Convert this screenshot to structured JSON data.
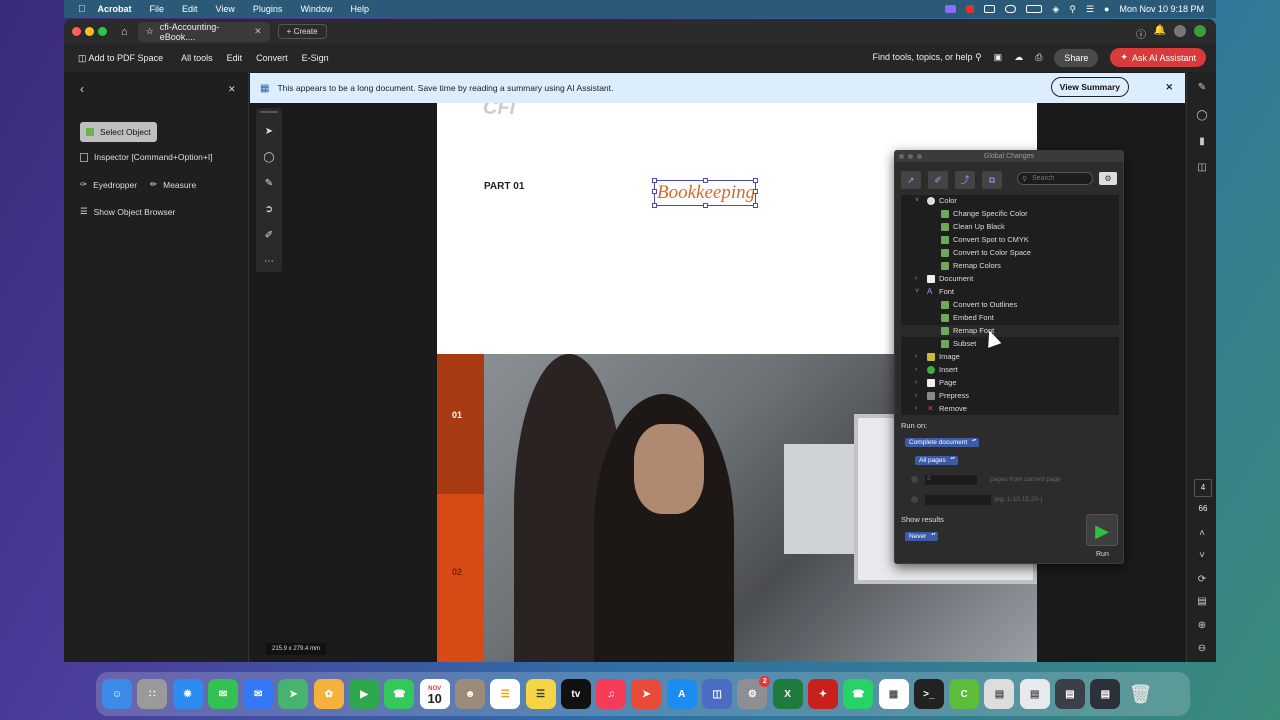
{
  "menubar": {
    "app": "Acrobat",
    "items": [
      "File",
      "Edit",
      "View",
      "Plugins",
      "Window",
      "Help"
    ],
    "clock": "Mon Nov 10  9:18 PM"
  },
  "tabs": {
    "active_tab": "cfi-Accounting-eBook....",
    "new_tab": "Create"
  },
  "toolbar": {
    "add_to_pdf_space": "Add to PDF Space",
    "all_tools": "All tools",
    "edit": "Edit",
    "convert": "Convert",
    "esign": "E-Sign",
    "find": "Find tools, topics, or help",
    "share": "Share",
    "ask_ai": "Ask AI Assistant"
  },
  "left_panel": {
    "select_object": "Select Object",
    "inspector": "Inspector [Command+Option+I]",
    "eyedropper": "Eyedropper",
    "measure": "Measure",
    "show_object_browser": "Show Object Browser"
  },
  "banner": {
    "text": "This appears to be a long document. Save time by reading a summary using AI Assistant.",
    "view_summary": "View Summary"
  },
  "document": {
    "header_logo": "CFI",
    "part_label": "PART 01",
    "title_word": "Bookkeeping",
    "num_01": "01",
    "num_02": "02",
    "dimensions": "215.9 x 279.4 mm"
  },
  "global_changes": {
    "title": "Global Changes",
    "search_placeholder": "Search",
    "tree": [
      {
        "label": "Color",
        "level": 0,
        "expanded": true
      },
      {
        "label": "Change Specific Color",
        "level": 1
      },
      {
        "label": "Clean Up Black",
        "level": 1
      },
      {
        "label": "Convert Spot to CMYK",
        "level": 1
      },
      {
        "label": "Convert to Color Space",
        "level": 1
      },
      {
        "label": "Remap Colors",
        "level": 1
      },
      {
        "label": "Document",
        "level": 0,
        "expanded": false
      },
      {
        "label": "Font",
        "level": 0,
        "expanded": true
      },
      {
        "label": "Convert to Outlines",
        "level": 1
      },
      {
        "label": "Embed Font",
        "level": 1
      },
      {
        "label": "Remap Font",
        "level": 1,
        "hovered": true
      },
      {
        "label": "Subset",
        "level": 1
      },
      {
        "label": "Image",
        "level": 0,
        "expanded": false
      },
      {
        "label": "Insert",
        "level": 0,
        "expanded": false
      },
      {
        "label": "Page",
        "level": 0,
        "expanded": false
      },
      {
        "label": "Prepress",
        "level": 0,
        "expanded": false
      },
      {
        "label": "Remove",
        "level": 0,
        "expanded": false
      }
    ],
    "run_on_label": "Run on:",
    "run_on_value": "Complete document",
    "pages_value": "All pages",
    "pages_from_current_value": "2",
    "pages_from_current_label": "pages from current page",
    "range_hint": "(eg: 1-10,15,20-)",
    "show_results_label": "Show results",
    "show_results_value": "Never",
    "run_label": "Run"
  },
  "right_rail": {
    "page_current": "4",
    "page_total": "66"
  },
  "dock": {
    "calendar_month": "NOV",
    "calendar_day": "10",
    "settings_badge": "2"
  }
}
